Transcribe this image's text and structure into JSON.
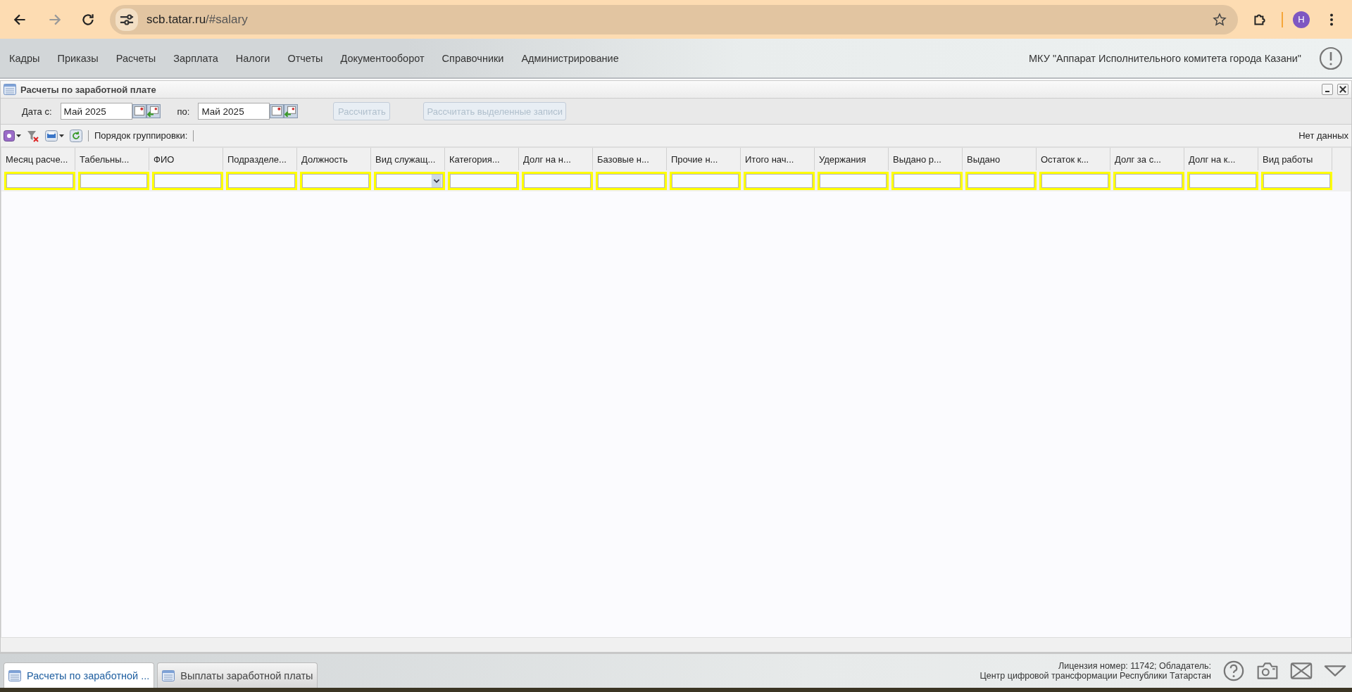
{
  "browser": {
    "url_host": "scb.tatar.ru",
    "url_path": "/#salary",
    "profile_initial": "Н"
  },
  "menu": {
    "items": [
      "Кадры",
      "Приказы",
      "Расчеты",
      "Зарплата",
      "Налоги",
      "Отчеты",
      "Документооборот",
      "Справочники",
      "Администрирование"
    ],
    "organization": "МКУ \"Аппарат Исполнительного комитета города Казани\""
  },
  "panel": {
    "title": "Расчеты по заработной плате"
  },
  "date_filter": {
    "from_label": "Дата с:",
    "from_value": "Май 2025",
    "to_label": "по:",
    "to_value": "Май 2025"
  },
  "buttons": [
    {
      "label": "Рассчитать",
      "disabled": true
    },
    {
      "label": "Рассчитать выделенные записи",
      "disabled": true
    }
  ],
  "toolbar": {
    "grouping_label": "Порядок группировки:",
    "status": "Нет данных"
  },
  "table": {
    "columns": [
      {
        "title": "Месяц расче...",
        "kind": "text"
      },
      {
        "title": "Табельны...",
        "kind": "text"
      },
      {
        "title": "ФИО",
        "kind": "text"
      },
      {
        "title": "Подразделе...",
        "kind": "text"
      },
      {
        "title": "Должность",
        "kind": "text"
      },
      {
        "title": "Вид служащ...",
        "kind": "select"
      },
      {
        "title": "Категория...",
        "kind": "text"
      },
      {
        "title": "Долг на н...",
        "kind": "text"
      },
      {
        "title": "Базовые н...",
        "kind": "text"
      },
      {
        "title": "Прочие н...",
        "kind": "text"
      },
      {
        "title": "Итого нач...",
        "kind": "text"
      },
      {
        "title": "Удержания",
        "kind": "text"
      },
      {
        "title": "Выдано р...",
        "kind": "text"
      },
      {
        "title": "Выдано",
        "kind": "text"
      },
      {
        "title": "Остаток к...",
        "kind": "text"
      },
      {
        "title": "Долг за с...",
        "kind": "text"
      },
      {
        "title": "Долг на к...",
        "kind": "text"
      },
      {
        "title": "Вид работы",
        "kind": "text"
      }
    ]
  },
  "bottom_tabs": [
    {
      "label": "Расчеты по заработной ...",
      "selected": true
    },
    {
      "label": "Выплаты заработной платы",
      "selected": false
    }
  ],
  "license": {
    "line_1": "Лицензия номер: 11742; Обладатель:",
    "line_2": "Центр цифровой трансформации Республики Татарстан"
  }
}
